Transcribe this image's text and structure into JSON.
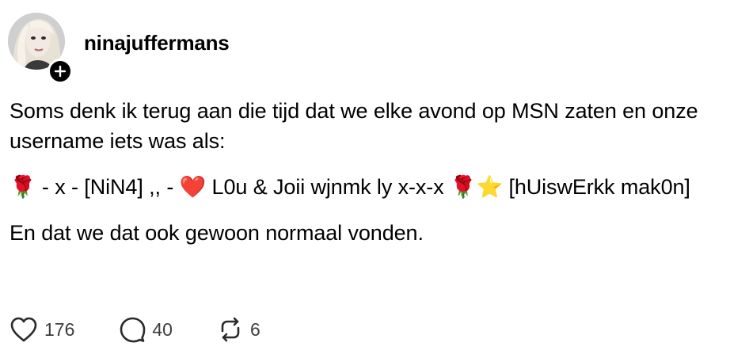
{
  "post": {
    "username": "ninajuffermans",
    "paragraphs": [
      "Soms denk ik terug aan die tijd dat we elke avond op MSN zaten en onze username iets was als:",
      "🌹 - x - [NiN4] ,, - ❤️ L0u & Joii wjnmk ly x-x-x 🌹⭐ [hUiswErkk mak0n]",
      "En dat we dat ook gewoon normaal vonden."
    ],
    "actions": {
      "likes": "176",
      "replies": "40",
      "reposts": "6"
    }
  },
  "icons": {
    "follow": "plus-icon",
    "like": "heart-icon",
    "reply": "comment-icon",
    "repost": "repost-icon"
  },
  "colors": {
    "text": "#000000",
    "muted": "#3c3c3c",
    "badge": "#000000"
  }
}
